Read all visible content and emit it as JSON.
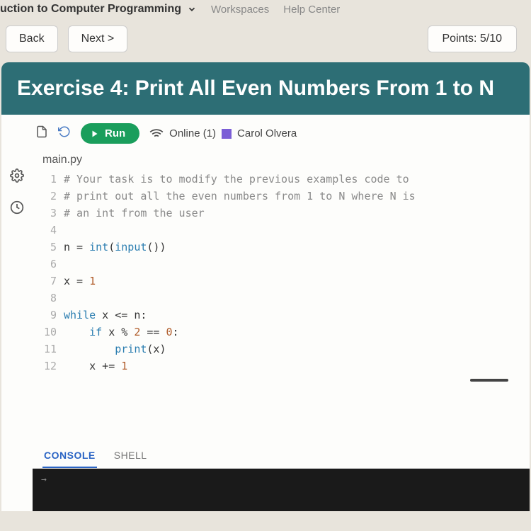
{
  "nav": {
    "course": "uction to Computer Programming",
    "workspaces": "Workspaces",
    "help": "Help Center"
  },
  "buttons": {
    "back": "Back",
    "next": "Next >",
    "points": "Points: 5/10"
  },
  "exercise": {
    "title": "Exercise 4: Print All Even Numbers From 1 to N"
  },
  "toolbar": {
    "run": "Run",
    "online": "Online (1)",
    "username": "Carol Olvera"
  },
  "file": {
    "name": "main.py"
  },
  "code": {
    "lines": [
      "# Your task is to modify the previous examples code to",
      "# print out all the even numbers from 1 to N where N is",
      "# an int from the user",
      "",
      "n = int(input())",
      "",
      "x = 1",
      "",
      "while x <= n:",
      "    if x % 2 == 0:",
      "        print(x)",
      "    x += 1"
    ],
    "gutter": [
      "1",
      "2",
      "3",
      "4",
      "5",
      "6",
      "7",
      "8",
      "9",
      "10",
      "11",
      "12"
    ]
  },
  "console": {
    "tab_console": "CONSOLE",
    "tab_shell": "SHELL",
    "prompt": "→"
  }
}
